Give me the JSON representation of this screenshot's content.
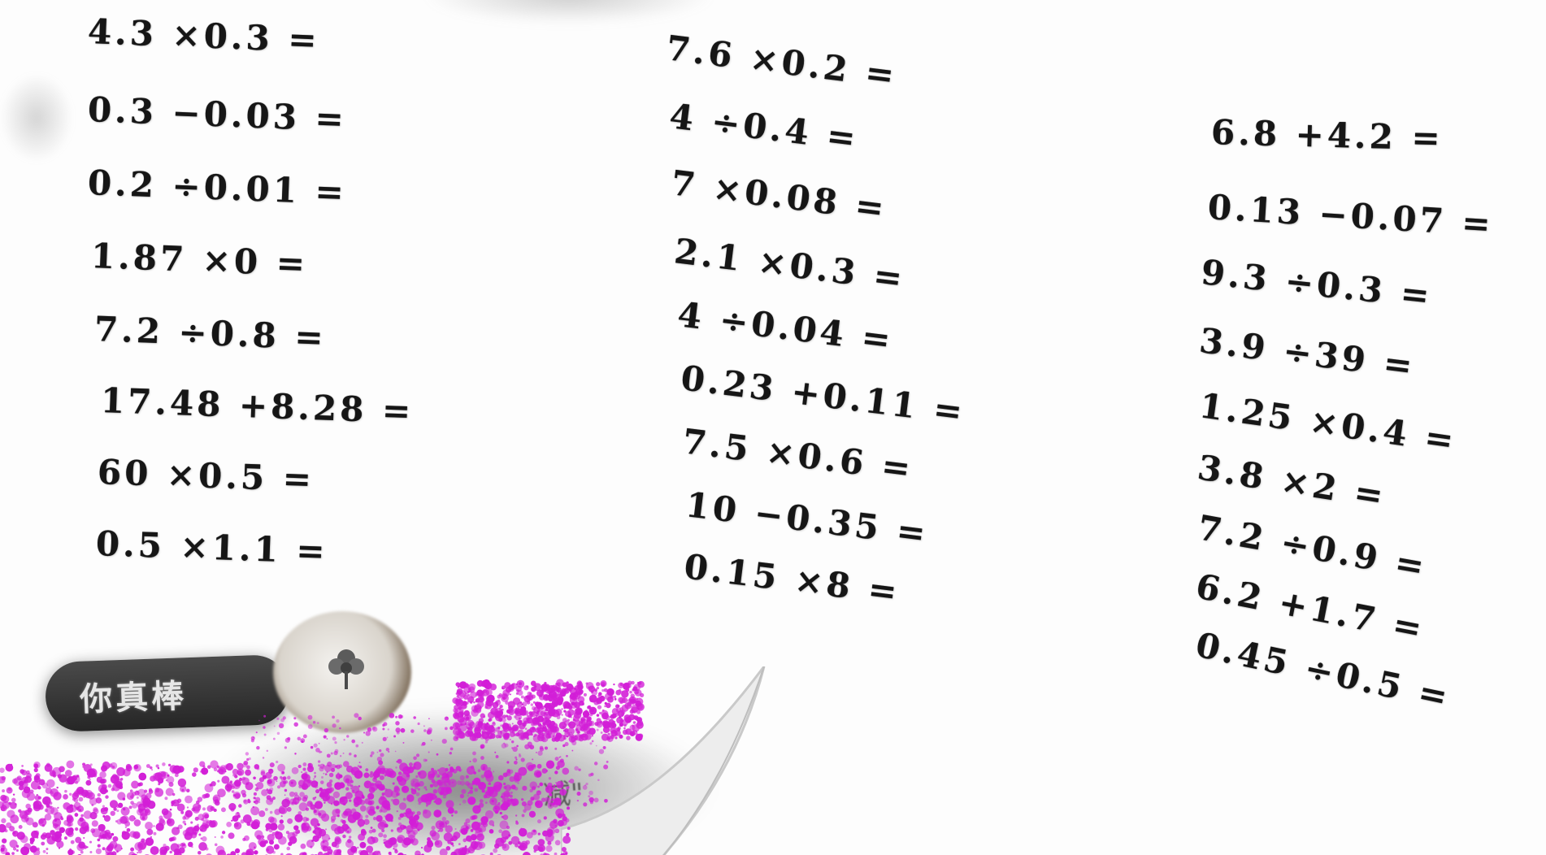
{
  "worksheet": {
    "column_1": [
      "4.3 ×0.3 =",
      "0.3 −0.03 =",
      "0.2 ÷0.01 =",
      "1.87 ×0 =",
      "7.2 ÷0.8 =",
      "17.48 +8.28 =",
      "60 ×0.5 =",
      "0.5 ×1.1 ="
    ],
    "column_2": [
      "7.6 ×0.2 =",
      "4 ÷0.4 =",
      "7 ×0.08 =",
      "2.1 ×0.3 =",
      "4 ÷0.04 =",
      "0.23 +0.11 =",
      "7.5 ×0.6 =",
      "10 −0.35 =",
      "0.15 ×8 ="
    ],
    "column_3": [
      "6.8 +4.2 =",
      "0.13 −0.07 =",
      "9.3 ÷0.3 =",
      "3.9 ÷39 =",
      "1.25 ×0.4 =",
      "3.8 ×2 =",
      "7.2 ÷0.9 =",
      "6.2 +1.7 =",
      "0.45 ÷0.5 ="
    ]
  },
  "badge": {
    "label": "你真棒",
    "icon": "flower-icon"
  },
  "fragment": {
    "text": "减\""
  },
  "colors": {
    "ink": "#161616",
    "badge_bg": "#2e2e2e",
    "noise": "#d21ed7"
  }
}
